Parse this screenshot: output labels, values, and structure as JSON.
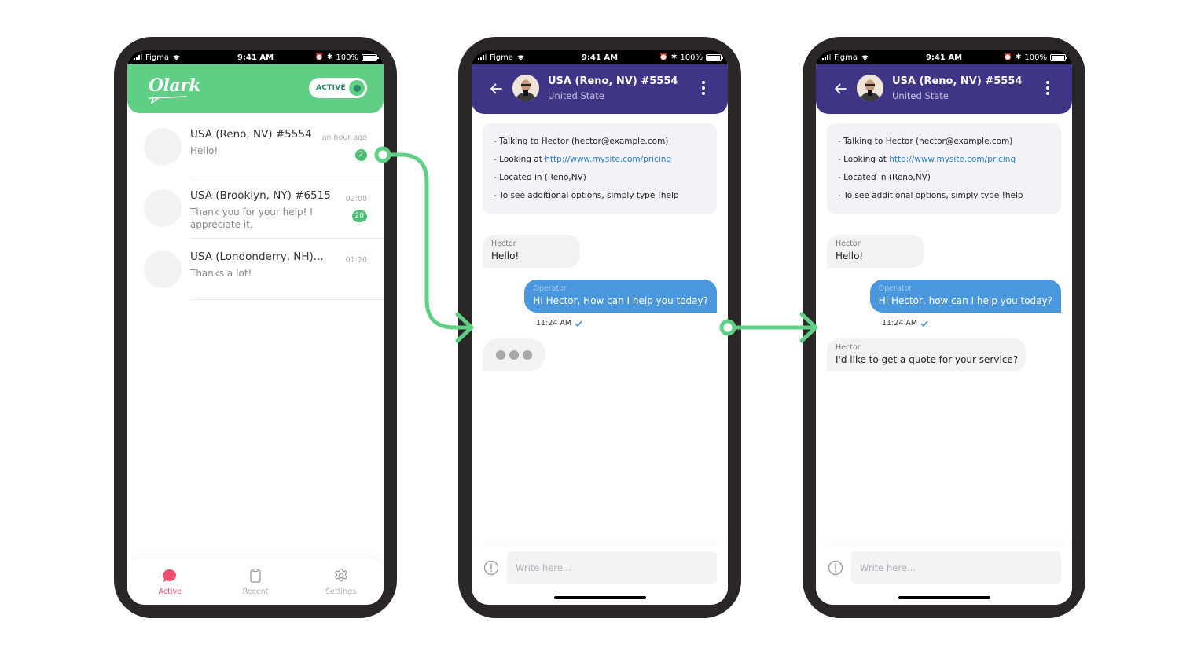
{
  "status_bar": {
    "carrier": "Figma",
    "time": "9:41 AM",
    "battery": "100%"
  },
  "screen_list": {
    "logo": "Olark",
    "status_toggle": {
      "label": "ACTIVE",
      "on": true
    },
    "conversations": [
      {
        "name": "USA (Reno, NV) #5554",
        "preview": "Hello!",
        "time": "an hour ago",
        "unread": "2"
      },
      {
        "name": "USA (Brooklyn, NY) #6515",
        "preview": "Thank you for your help! I appreciate it.",
        "time": "02:00",
        "unread": "20"
      },
      {
        "name": "USA (Londonderry, NH)...",
        "preview": "Thanks a lot!",
        "time": "01:20",
        "unread": null
      }
    ],
    "tabs": [
      {
        "label": "Active",
        "icon": "chat-bubble-icon",
        "active": true
      },
      {
        "label": "Recent",
        "icon": "clipboard-icon",
        "active": false
      },
      {
        "label": "Settings",
        "icon": "gear-icon",
        "active": false
      }
    ]
  },
  "screen_chat_1": {
    "header": {
      "title": "USA (Reno, NV) #5554",
      "subtitle": "United State"
    },
    "info": {
      "line1": "- Talking to Hector (hector@example.com)",
      "line2_prefix": "- Looking at ",
      "line2_link": "http://www.mysite.com/pricing",
      "line3": "- Located in (Reno,NV)",
      "line4": "- To see additional options, simply type !help"
    },
    "messages": [
      {
        "sender": "Hector",
        "text": "Hello!"
      },
      {
        "sender": "Operator",
        "text": "Hi Hector, How can I help you today?",
        "time": "11:24 AM"
      }
    ],
    "typing_indicator": true,
    "composer": {
      "placeholder": "Write here..."
    }
  },
  "screen_chat_2": {
    "header": {
      "title": "USA (Reno, NV) #5554",
      "subtitle": "United State"
    },
    "info": {
      "line1": "- Talking to Hector (hector@example.com)",
      "line2_prefix": "- Looking at ",
      "line2_link": "http://www.mysite.com/pricing",
      "line3": "- Located in (Reno,NV)",
      "line4": "- To see additional options, simply type !help"
    },
    "messages": [
      {
        "sender": "Hector",
        "text": "Hello!"
      },
      {
        "sender": "Operator",
        "text": "Hi Hector, how can I help you today?",
        "time": "11:24 AM"
      },
      {
        "sender": "Hector",
        "text": "I'd like to get a quote for your service?"
      }
    ],
    "composer": {
      "placeholder": "Write here..."
    }
  },
  "colors": {
    "olark_green": "#5ecf84",
    "chat_purple": "#3e3586",
    "operator_blue": "#4b97dd",
    "active_pink": "#f24c6e",
    "phone_frame": "#2b2726",
    "connector_green": "#5ecf84"
  }
}
